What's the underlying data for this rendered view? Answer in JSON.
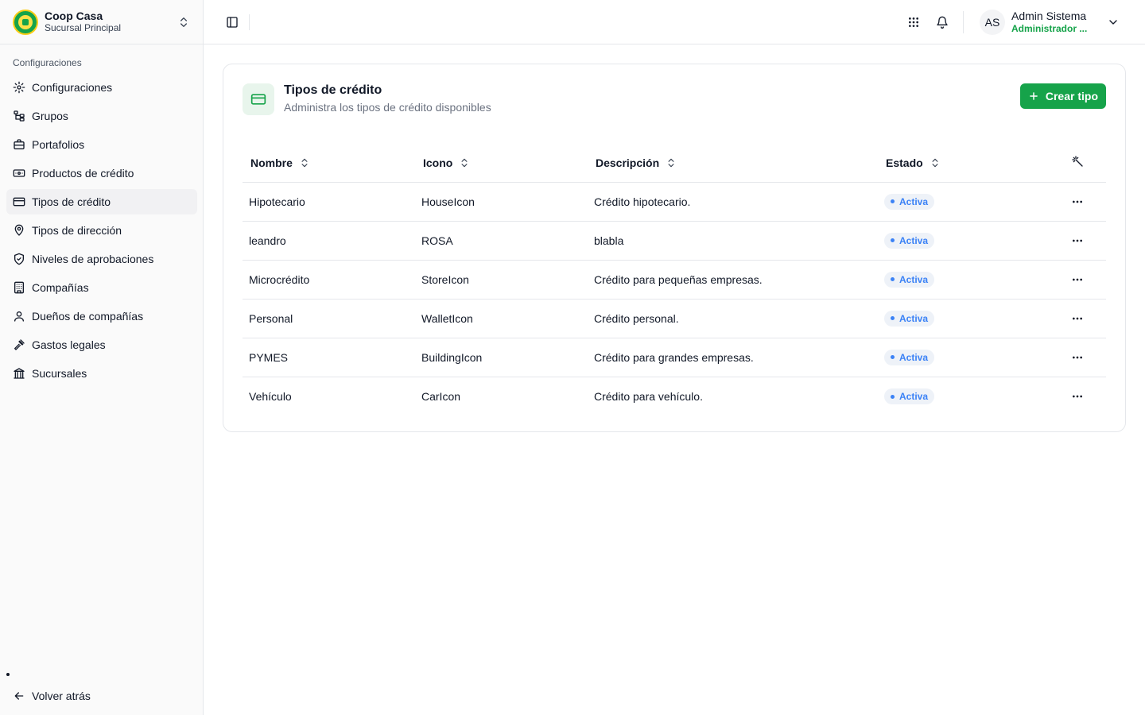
{
  "org": {
    "name": "Coop Casa",
    "branch": "Sucursal Principal"
  },
  "sidebar": {
    "section_label": "Configuraciones",
    "items": [
      {
        "label": "Configuraciones",
        "icon": "gear-icon"
      },
      {
        "label": "Grupos",
        "icon": "group-tree-icon"
      },
      {
        "label": "Portafolios",
        "icon": "briefcase-icon"
      },
      {
        "label": "Productos de crédito",
        "icon": "banknote-icon"
      },
      {
        "label": "Tipos de crédito",
        "icon": "credit-card-icon",
        "active": true
      },
      {
        "label": "Tipos de dirección",
        "icon": "map-pin-icon"
      },
      {
        "label": "Niveles de aprobaciones",
        "icon": "shield-check-icon"
      },
      {
        "label": "Compañías",
        "icon": "building-icon"
      },
      {
        "label": "Dueños de compañías",
        "icon": "user-icon"
      },
      {
        "label": "Gastos legales",
        "icon": "gavel-icon"
      },
      {
        "label": "Sucursales",
        "icon": "bank-icon"
      }
    ],
    "back_label": "Volver atrás"
  },
  "header": {
    "user": {
      "initials": "AS",
      "name": "Admin Sistema",
      "role": "Administrador ..."
    }
  },
  "card": {
    "title": "Tipos de crédito",
    "description": "Administra los tipos de crédito disponibles",
    "create_label": "Crear tipo"
  },
  "table": {
    "columns": [
      "Nombre",
      "Icono",
      "Descripción",
      "Estado"
    ],
    "rows": [
      {
        "nombre": "Hipotecario",
        "icono": "HouseIcon",
        "descripcion": "Crédito hipotecario.",
        "estado": "Activa"
      },
      {
        "nombre": "leandro",
        "icono": "ROSA",
        "descripcion": "blabla",
        "estado": "Activa"
      },
      {
        "nombre": "Microcrédito",
        "icono": "StoreIcon",
        "descripcion": "Crédito para pequeñas empresas.",
        "estado": "Activa"
      },
      {
        "nombre": "Personal",
        "icono": "WalletIcon",
        "descripcion": "Crédito personal.",
        "estado": "Activa"
      },
      {
        "nombre": "PYMES",
        "icono": "BuildingIcon",
        "descripcion": "Crédito para grandes empresas.",
        "estado": "Activa"
      },
      {
        "nombre": "Vehículo",
        "icono": "CarIcon",
        "descripcion": "Crédito para vehículo.",
        "estado": "Activa"
      }
    ]
  },
  "colors": {
    "brand": "#16a34a",
    "status": "#3b82f6"
  }
}
